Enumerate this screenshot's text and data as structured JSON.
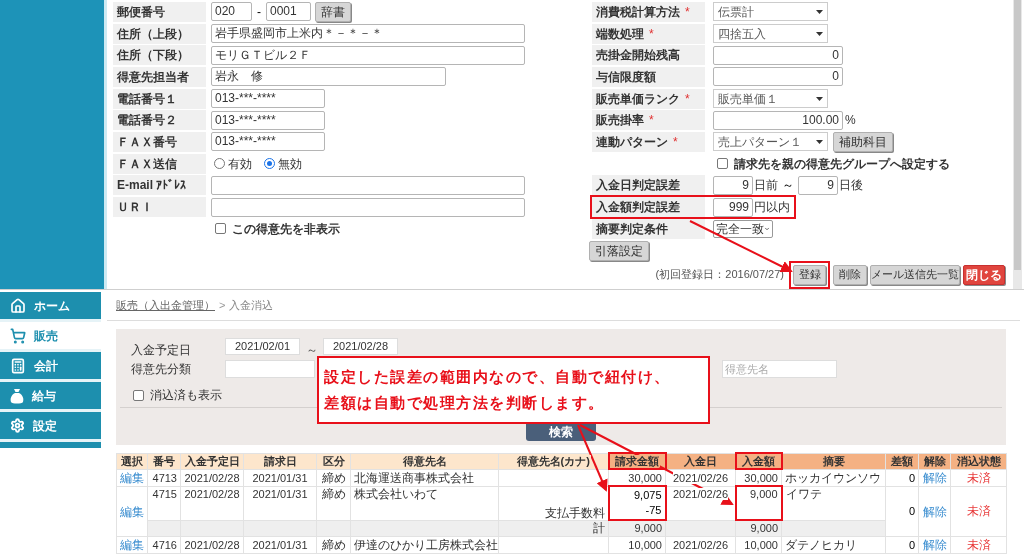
{
  "top_form": {
    "left_rows": [
      {
        "kind": "postal",
        "label": "郵便番号",
        "values": [
          "020",
          "0001"
        ],
        "separator": "-",
        "button": "辞書"
      },
      {
        "kind": "text",
        "label": "住所（上段）",
        "value": "岩手県盛岡市上米内＊－＊－＊"
      },
      {
        "kind": "text",
        "label": "住所（下段）",
        "value": "モリＧＴビル２Ｆ"
      },
      {
        "kind": "text",
        "label": "得意先担当者",
        "value": "岩永　修"
      },
      {
        "kind": "text",
        "label": "電話番号１",
        "value": "013-***-****"
      },
      {
        "kind": "text",
        "label": "電話番号２",
        "value": "013-***-****"
      },
      {
        "kind": "text",
        "label": "ＦＡＸ番号",
        "value": "013-***-****"
      },
      {
        "kind": "radio",
        "label": "ＦＡＸ送信",
        "options": [
          {
            "label": "有効",
            "selected": false
          },
          {
            "label": "無効",
            "selected": true
          }
        ]
      },
      {
        "kind": "text",
        "label": "E-mail ｱﾄﾞﾚｽ"
      },
      {
        "kind": "text",
        "label": "ＵＲＩ"
      },
      {
        "kind": "checkbox",
        "label": "この得意先を非表示",
        "checked": false
      }
    ],
    "right_rows": [
      {
        "kind": "select",
        "label": "消費税計算方法",
        "required_mark": "*",
        "value": "伝票計"
      },
      {
        "kind": "select",
        "label": "端数処理",
        "required_mark": "*",
        "value": "四捨五入"
      },
      {
        "kind": "number",
        "label": "売掛金開始残高",
        "value": "0"
      },
      {
        "kind": "number",
        "label": "与信限度額",
        "value": "0"
      },
      {
        "kind": "select",
        "label": "販売単価ランク",
        "required_mark": "*",
        "value": "販売単価１"
      },
      {
        "kind": "number",
        "label": "販売掛率",
        "required_mark": "*",
        "value": "100.00",
        "unit": "%"
      },
      {
        "kind": "select",
        "label": "連動パターン",
        "required_mark": "*",
        "value": "売上パターン１",
        "button": "補助科目"
      },
      {
        "kind": "checkbox",
        "label": "請求先を親の得意先グループへ設定する",
        "checked": false
      },
      {
        "kind": "range",
        "label": "入金日判定誤差",
        "from": "9",
        "from_unit": "日前",
        "separator": "～",
        "to": "9",
        "to_unit": "日後"
      },
      {
        "kind": "small_number",
        "label": "入金額判定誤差",
        "value": "999",
        "unit": "円以内",
        "highlighted": true
      },
      {
        "kind": "native_select",
        "label": "摘要判定条件",
        "value": "完全一致"
      }
    ],
    "withdrawal_button": "引落設定",
    "first_registered": "(初回登録日：2016/07/27)",
    "actions": [
      {
        "label": "登録",
        "kind": "default",
        "highlighted": true
      },
      {
        "label": "削除",
        "kind": "default",
        "highlighted": false
      },
      {
        "label": "メール送信先一覧",
        "kind": "default",
        "highlighted": false
      },
      {
        "label": "閉じる",
        "kind": "danger",
        "highlighted": false
      }
    ]
  },
  "sidebar": [
    {
      "label": "ホーム",
      "selected": false
    },
    {
      "label": "販売",
      "selected": true
    },
    {
      "label": "会計",
      "selected": false
    },
    {
      "label": "給与",
      "selected": false
    },
    {
      "label": "設定",
      "selected": false
    }
  ],
  "breadcrumb": {
    "link": "販売（入出金管理）",
    "separator": ">",
    "current": "入金消込"
  },
  "search": {
    "date_label": "入金予定日",
    "date_from": "2021/02/01",
    "tilde": "～",
    "date_to": "2021/02/28",
    "category_label": "得意先分類",
    "name_placeholder": "得意先名",
    "show_cleared": {
      "label": "消込済も表示",
      "checked": false
    },
    "button": "検索"
  },
  "table": {
    "columns": [
      {
        "label": "選択",
        "highlighted": false
      },
      {
        "label": "番号",
        "highlighted": false
      },
      {
        "label": "入金予定日",
        "highlighted": false
      },
      {
        "label": "請求日",
        "highlighted": false
      },
      {
        "label": "区分",
        "highlighted": false
      },
      {
        "label": "得意先名",
        "highlighted": false
      },
      {
        "label": "得意先名(カナ)",
        "highlighted": false
      },
      {
        "label": "請求金額",
        "highlighted": true
      },
      {
        "label": "入金日",
        "highlighted": false
      },
      {
        "label": "入金額",
        "highlighted": true
      },
      {
        "label": "摘要",
        "highlighted": false
      },
      {
        "label": "差額",
        "highlighted": false
      },
      {
        "label": "解除",
        "highlighted": false
      },
      {
        "label": "消込状態",
        "highlighted": false
      }
    ],
    "rows": [
      {
        "edit": "編集",
        "number": "4713",
        "due": "2021/02/28",
        "billed_on": "2021/01/31",
        "type": "締め",
        "customer": "北海運送商事株式会社",
        "billed": "30,000",
        "paid_on": "2021/02/26",
        "received": "30,000",
        "memo": "ホッカイウンソウ",
        "difference": "0",
        "cancel": "解除",
        "status": "未済",
        "highlighted": false
      },
      {
        "edit": "編集",
        "number": "4715",
        "due": "2021/02/28",
        "billed_on": "2021/01/31",
        "type": "締め",
        "customer": "株式会社いわて",
        "billed": "9,075",
        "paid_on": "2021/02/26",
        "received": "9,000",
        "memo": "イワテ",
        "difference": "0",
        "cancel": "解除",
        "status": "未済",
        "highlighted": true,
        "fee": {
          "label": "支払手数料",
          "amount": "-75"
        },
        "total": {
          "label": "計",
          "billed": "9,000",
          "received": "9,000"
        }
      },
      {
        "edit": "編集",
        "number": "4716",
        "due": "2021/02/28",
        "billed_on": "2021/01/31",
        "type": "締め",
        "customer": "伊達のひかり工房株式会社",
        "billed": "10,000",
        "paid_on": "2021/02/26",
        "received": "10,000",
        "memo": "ダテノヒカリ",
        "difference": "0",
        "cancel": "解除",
        "status": "未済",
        "highlighted": false
      }
    ]
  },
  "annotation": {
    "lines": [
      "設定した誤差の範囲内なので、自動で紐付け、",
      "差額は自動で処理方法を判断します。"
    ]
  }
}
